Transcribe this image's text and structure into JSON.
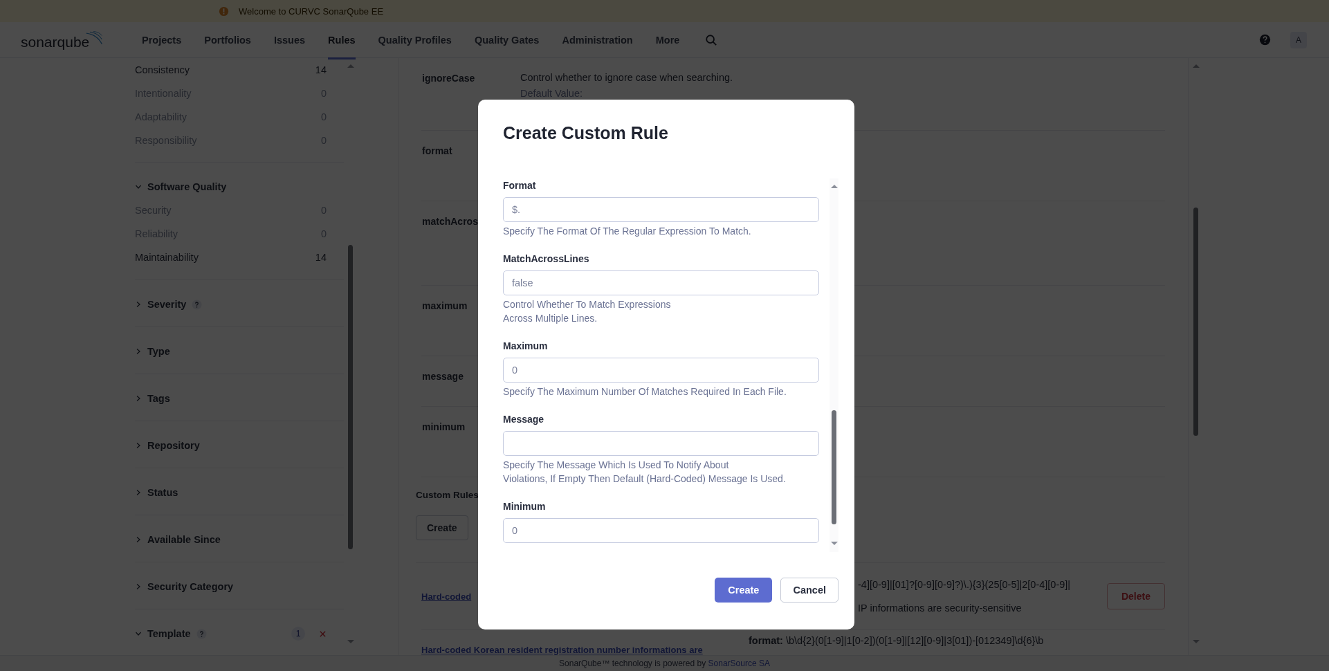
{
  "banner": {
    "text": "Welcome to CURVC SonarQube EE"
  },
  "nav": {
    "logo_text": "sonar",
    "logo_bold": "qube",
    "items": [
      {
        "label": "Projects",
        "selected": false
      },
      {
        "label": "Portfolios",
        "selected": false
      },
      {
        "label": "Issues",
        "selected": false
      },
      {
        "label": "Rules",
        "selected": true
      },
      {
        "label": "Quality Profiles",
        "selected": false
      },
      {
        "label": "Quality Gates",
        "selected": false
      },
      {
        "label": "Administration",
        "selected": false
      },
      {
        "label": "More",
        "selected": false
      }
    ],
    "avatar": "A"
  },
  "sidebar": {
    "items": [
      {
        "label": "Consistency",
        "count": "14",
        "disabled": false
      },
      {
        "label": "Intentionality",
        "count": "0",
        "disabled": true
      },
      {
        "label": "Adaptability",
        "count": "0",
        "disabled": true
      },
      {
        "label": "Responsibility",
        "count": "0",
        "disabled": true
      }
    ],
    "sections": [
      {
        "title": "Software Quality",
        "expanded": true,
        "help": false,
        "items": [
          {
            "label": "Security",
            "count": "0",
            "disabled": true
          },
          {
            "label": "Reliability",
            "count": "0",
            "disabled": true
          },
          {
            "label": "Maintainability",
            "count": "14",
            "disabled": false
          }
        ]
      },
      {
        "title": "Severity",
        "expanded": false,
        "help": true
      },
      {
        "title": "Type",
        "expanded": false,
        "help": false
      },
      {
        "title": "Tags",
        "expanded": false,
        "help": false
      },
      {
        "title": "Repository",
        "expanded": false,
        "help": false
      },
      {
        "title": "Status",
        "expanded": false,
        "help": false
      },
      {
        "title": "Available Since",
        "expanded": false,
        "help": false
      },
      {
        "title": "Security Category",
        "expanded": false,
        "help": false
      },
      {
        "title": "Template",
        "expanded": true,
        "help": true,
        "count": "1",
        "clearable": true
      }
    ]
  },
  "parameters": [
    {
      "name": "ignoreCase",
      "description": "Control whether to ignore case when searching.",
      "default_label": "Default Value:"
    },
    {
      "name": "format"
    },
    {
      "name": "matchAcros"
    },
    {
      "name": "maximum"
    },
    {
      "name": "message"
    },
    {
      "name": "minimum"
    }
  ],
  "custom_rules": {
    "title": "Custom Rules",
    "create_button": "Create",
    "rows": [
      {
        "link": "Hard-coded",
        "lines": [
          "-4][0-9]|[01]?[0-9][0-9]?)\\.){3}(25[0-5]|2[0-4][0-9]|",
          "IP informations are security-sensitive"
        ],
        "delete_button": "Delete"
      },
      {
        "link": "Hard-coded Korean resident registration number informations are",
        "lines": [
          "**format:** \\b\\d{2}(0[1-9]|1[0-2])(0[1-9]|[12][0-9]|3[01])-[012349]\\d{6}\\b"
        ]
      }
    ]
  },
  "modal": {
    "title": "Create Custom Rule",
    "fields": [
      {
        "label": "Format",
        "placeholder": "$.",
        "hint": [
          "Specify The Format Of The Regular Expression To Match."
        ]
      },
      {
        "label": "MatchAcrossLines",
        "placeholder": "false",
        "hint": [
          "Control Whether To Match Expressions",
          "Across Multiple Lines."
        ]
      },
      {
        "label": "Maximum",
        "placeholder": "0",
        "hint": [
          "Specify The Maximum Number Of Matches Required In Each File."
        ]
      },
      {
        "label": "Message",
        "hint": [
          "Specify The Message Which Is Used To Notify About",
          "Violations, If Empty Then Default (Hard-Coded) Message Is Used."
        ]
      },
      {
        "label": "Minimum",
        "placeholder": "0"
      }
    ],
    "primary_button": "Create",
    "cancel_button": "Cancel"
  },
  "footer": {
    "text": "SonarQube™ technology is powered by",
    "link": "SonarSource SA"
  }
}
